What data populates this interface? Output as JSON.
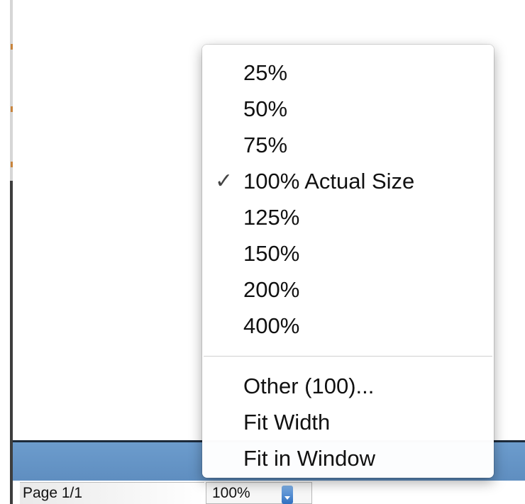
{
  "status_bar": {
    "page_label": "Page 1/1",
    "zoom_value": "100%"
  },
  "zoom_menu": {
    "checked_item": "100% Actual Size",
    "check_mark": "✓",
    "items": [
      {
        "label": "25%"
      },
      {
        "label": "50%"
      },
      {
        "label": "75%"
      },
      {
        "label": "100% Actual Size"
      },
      {
        "label": "125%"
      },
      {
        "label": "150%"
      },
      {
        "label": "200%"
      },
      {
        "label": "400%"
      }
    ],
    "extra_items": [
      {
        "label": "Other (100)..."
      },
      {
        "label": "Fit Width"
      },
      {
        "label": "Fit in Window"
      }
    ]
  },
  "colors": {
    "status_band": "#6c9ccd",
    "select_arrow": "#2f6fc0"
  }
}
